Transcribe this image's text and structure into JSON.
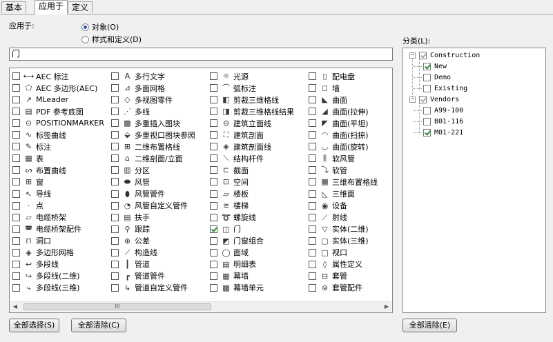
{
  "tabs": [
    "基本",
    "应用于",
    "定义"
  ],
  "apply_to_label": "应用于:",
  "radio_object": "对象(O)",
  "radio_style": "样式和定义(D)",
  "filter_value": "门",
  "category_label": "分类(L):",
  "buttons": {
    "select_all": "全部选择(S)",
    "clear_all": "全部清除(C)",
    "clear_all_cat": "全部清除(E)"
  },
  "columns": [
    [
      {
        "label": "AEC 标注",
        "checked": false,
        "icon": "dimension-icon",
        "glyph": "⟷"
      },
      {
        "label": "AEC 多边形(AEC)",
        "checked": false,
        "icon": "polygon-icon",
        "glyph": "⬠"
      },
      {
        "label": "MLeader",
        "checked": false,
        "icon": "mleader-icon",
        "glyph": "↗"
      },
      {
        "label": "PDF 参考底图",
        "checked": false,
        "icon": "pdf-icon",
        "glyph": "▤"
      },
      {
        "label": "POSITIONMARKER",
        "checked": false,
        "icon": "position-marker-icon",
        "glyph": "⊙"
      },
      {
        "label": "标签曲线",
        "checked": false,
        "icon": "tag-curve-icon",
        "glyph": "∿"
      },
      {
        "label": "标注",
        "checked": false,
        "icon": "annotation-icon",
        "glyph": "✎"
      },
      {
        "label": "表",
        "checked": false,
        "icon": "table-icon",
        "glyph": "▦"
      },
      {
        "label": "布置曲线",
        "checked": false,
        "icon": "layout-curve-icon",
        "glyph": "ᔕ"
      },
      {
        "label": "窗",
        "checked": false,
        "icon": "window-icon",
        "glyph": "⊞"
      },
      {
        "label": "导线",
        "checked": false,
        "icon": "leader-icon",
        "glyph": "↖"
      },
      {
        "label": "点",
        "checked": false,
        "icon": "point-icon",
        "glyph": "·"
      },
      {
        "label": "电缆桥架",
        "checked": false,
        "icon": "cable-tray-icon",
        "glyph": "▱"
      },
      {
        "label": "电缆桥架配件",
        "checked": false,
        "icon": "cable-tray-fitting-icon",
        "glyph": "◚"
      },
      {
        "label": "洞口",
        "checked": false,
        "icon": "opening-icon",
        "glyph": "⊓"
      },
      {
        "label": "多边形网格",
        "checked": false,
        "icon": "polygon-mesh-icon",
        "glyph": "◈"
      },
      {
        "label": "多段线",
        "checked": false,
        "icon": "polyline-icon",
        "glyph": "↩"
      },
      {
        "label": "多段线(二维)",
        "checked": false,
        "icon": "polyline-2d-icon",
        "glyph": "↪"
      },
      {
        "label": "多段线(三维)",
        "checked": false,
        "icon": "polyline-3d-icon",
        "glyph": "⤷"
      }
    ],
    [
      {
        "label": "多行文字",
        "checked": false,
        "icon": "mtext-icon",
        "glyph": "A"
      },
      {
        "label": "多面网格",
        "checked": false,
        "icon": "polyface-mesh-icon",
        "glyph": "⊿"
      },
      {
        "label": "多视图零件",
        "checked": false,
        "icon": "multiview-part-icon",
        "glyph": "◇"
      },
      {
        "label": "多线",
        "checked": false,
        "icon": "multiline-icon",
        "glyph": "⋰"
      },
      {
        "label": "多重插入图块",
        "checked": false,
        "icon": "minsert-icon",
        "glyph": "▩"
      },
      {
        "label": "多重视口图块参照",
        "checked": false,
        "icon": "mvblock-ref-icon",
        "glyph": "⬙"
      },
      {
        "label": "二维布置格线",
        "checked": false,
        "icon": "grid-2d-icon",
        "glyph": "⊞"
      },
      {
        "label": "二维剖面/立面",
        "checked": false,
        "icon": "section-2d-icon",
        "glyph": "⌂"
      },
      {
        "label": "分区",
        "checked": false,
        "icon": "zone-icon",
        "glyph": "▥"
      },
      {
        "label": "风管",
        "checked": false,
        "icon": "duct-icon",
        "glyph": "⬬"
      },
      {
        "label": "风管管件",
        "checked": false,
        "icon": "duct-fitting-icon",
        "glyph": "⬮"
      },
      {
        "label": "风管自定义管件",
        "checked": false,
        "icon": "duct-custom-fitting-icon",
        "glyph": "◔"
      },
      {
        "label": "扶手",
        "checked": false,
        "icon": "railing-icon",
        "glyph": "▤"
      },
      {
        "label": "跟踪",
        "checked": false,
        "icon": "trace-icon",
        "glyph": "⚲"
      },
      {
        "label": "公差",
        "checked": false,
        "icon": "tolerance-icon",
        "glyph": "⊕"
      },
      {
        "label": "构造线",
        "checked": false,
        "icon": "xline-icon",
        "glyph": "⟋"
      },
      {
        "label": "管道",
        "checked": false,
        "icon": "pipe-icon",
        "glyph": "┃"
      },
      {
        "label": "管道管件",
        "checked": false,
        "icon": "pipe-fitting-icon",
        "glyph": "┏"
      },
      {
        "label": "管道自定义管件",
        "checked": false,
        "icon": "pipe-custom-fitting-icon",
        "glyph": "↳"
      }
    ],
    [
      {
        "label": "光源",
        "checked": false,
        "icon": "light-icon",
        "glyph": "☼"
      },
      {
        "label": "弧标注",
        "checked": false,
        "icon": "arc-dimension-icon",
        "glyph": "⌒"
      },
      {
        "label": "剪裁三维格线",
        "checked": false,
        "icon": "clip-3d-grid-icon",
        "glyph": "◧"
      },
      {
        "label": "剪裁三维格线结果",
        "checked": false,
        "icon": "clip-3d-grid-result-icon",
        "glyph": "◨"
      },
      {
        "label": "建筑立面线",
        "checked": false,
        "icon": "elevation-line-icon",
        "glyph": "⊖"
      },
      {
        "label": "建筑剖面",
        "checked": false,
        "icon": "building-section-icon",
        "glyph": "⛶"
      },
      {
        "label": "建筑剖面线",
        "checked": false,
        "icon": "section-line-icon",
        "glyph": "◈"
      },
      {
        "label": "结构杆件",
        "checked": false,
        "icon": "structural-member-icon",
        "glyph": "⟍"
      },
      {
        "label": "截面",
        "checked": false,
        "icon": "section-icon",
        "glyph": "⊏"
      },
      {
        "label": "空间",
        "checked": false,
        "icon": "space-icon",
        "glyph": "⊡"
      },
      {
        "label": "楼板",
        "checked": false,
        "icon": "slab-icon",
        "glyph": "▱"
      },
      {
        "label": "楼梯",
        "checked": false,
        "icon": "stair-icon",
        "glyph": "≋"
      },
      {
        "label": "螺旋线",
        "checked": false,
        "icon": "helix-icon",
        "glyph": "➰"
      },
      {
        "label": "门",
        "checked": true,
        "icon": "door-icon",
        "glyph": "◫"
      },
      {
        "label": "门窗组合",
        "checked": false,
        "icon": "door-window-assembly-icon",
        "glyph": "◩"
      },
      {
        "label": "面域",
        "checked": false,
        "icon": "region-icon",
        "glyph": "◯"
      },
      {
        "label": "明细表",
        "checked": false,
        "icon": "schedule-icon",
        "glyph": "▤"
      },
      {
        "label": "幕墙",
        "checked": false,
        "icon": "curtain-wall-icon",
        "glyph": "▦"
      },
      {
        "label": "幕墙单元",
        "checked": false,
        "icon": "curtain-wall-unit-icon",
        "glyph": "▩"
      }
    ],
    [
      {
        "label": "配电盘",
        "checked": false,
        "icon": "panel-icon",
        "glyph": "▯"
      },
      {
        "label": "墙",
        "checked": false,
        "icon": "wall-icon",
        "glyph": "◻"
      },
      {
        "label": "曲面",
        "checked": false,
        "icon": "surface-icon",
        "glyph": "◣"
      },
      {
        "label": "曲面(拉伸)",
        "checked": false,
        "icon": "surface-extrude-icon",
        "glyph": "◢"
      },
      {
        "label": "曲面(平坦)",
        "checked": false,
        "icon": "surface-flat-icon",
        "glyph": "◤"
      },
      {
        "label": "曲面(扫掠)",
        "checked": false,
        "icon": "surface-sweep-icon",
        "glyph": "◠"
      },
      {
        "label": "曲面(旋转)",
        "checked": false,
        "icon": "surface-revolve-icon",
        "glyph": "◡"
      },
      {
        "label": "软风管",
        "checked": false,
        "icon": "flex-duct-icon",
        "glyph": "⫼"
      },
      {
        "label": "软管",
        "checked": false,
        "icon": "flex-pipe-icon",
        "glyph": "⤵"
      },
      {
        "label": "三维布置格线",
        "checked": false,
        "icon": "grid-3d-icon",
        "glyph": "▦"
      },
      {
        "label": "三维面",
        "checked": false,
        "icon": "face-3d-icon",
        "glyph": "◺"
      },
      {
        "label": "设备",
        "checked": false,
        "icon": "device-icon",
        "glyph": "◉"
      },
      {
        "label": "射线",
        "checked": false,
        "icon": "ray-icon",
        "glyph": "⟋"
      },
      {
        "label": "实体(二维)",
        "checked": false,
        "icon": "solid-2d-icon",
        "glyph": "▽"
      },
      {
        "label": "实体(三维)",
        "checked": false,
        "icon": "solid-3d-icon",
        "glyph": "▢"
      },
      {
        "label": "视口",
        "checked": false,
        "icon": "viewport-icon",
        "glyph": "□"
      },
      {
        "label": "属性定义",
        "checked": false,
        "icon": "attribute-def-icon",
        "glyph": "◊"
      },
      {
        "label": "套管",
        "checked": false,
        "icon": "sleeve-icon",
        "glyph": "⊟"
      },
      {
        "label": "套管配件",
        "checked": false,
        "icon": "sleeve-fitting-icon",
        "glyph": "⊜"
      }
    ]
  ],
  "tree": [
    {
      "label": "Construction",
      "checked": true,
      "gray": true,
      "level": 0,
      "expand": "−"
    },
    {
      "label": "New",
      "checked": true,
      "gray": false,
      "level": 1
    },
    {
      "label": "Demo",
      "checked": false,
      "gray": false,
      "level": 1
    },
    {
      "label": "Existing",
      "checked": false,
      "gray": false,
      "level": 1
    },
    {
      "label": "Vendors",
      "checked": true,
      "gray": true,
      "level": 0,
      "expand": "−"
    },
    {
      "label": "A99-100",
      "checked": false,
      "gray": false,
      "level": 1
    },
    {
      "label": "B01-116",
      "checked": false,
      "gray": false,
      "level": 1
    },
    {
      "label": "M01-221",
      "checked": true,
      "gray": false,
      "level": 1
    }
  ],
  "scroll_thumb": "III"
}
